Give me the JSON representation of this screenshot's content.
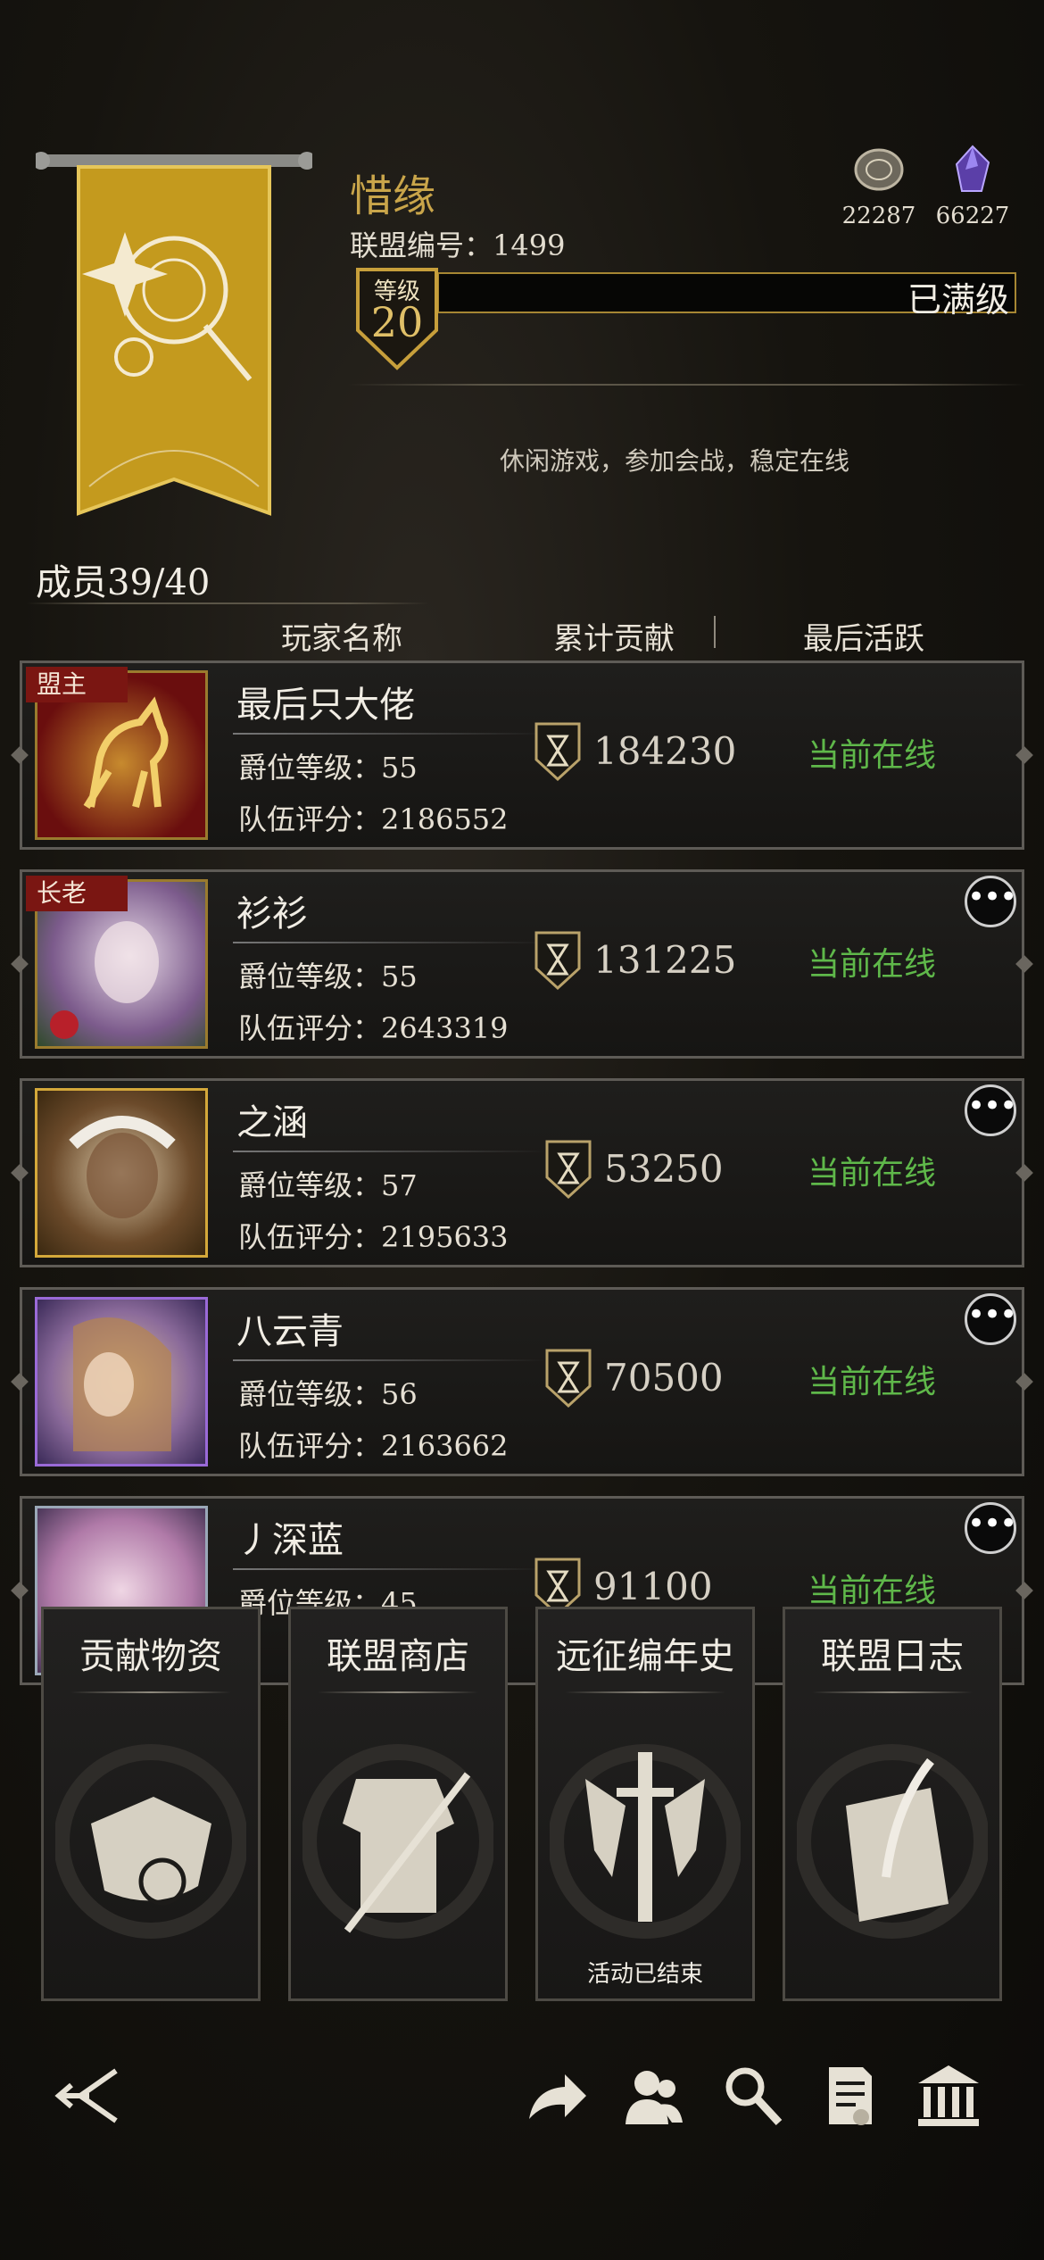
{
  "alliance": {
    "name": "惜缘",
    "id_label": "联盟编号：1499",
    "level_label": "等级",
    "level": "20",
    "level_status": "已满级",
    "slogan": "休闲游戏，参加会战，稳定在线",
    "members": "成员39/40"
  },
  "currencies": [
    {
      "icon": "coin-icon",
      "value": "22287"
    },
    {
      "icon": "crystal-icon",
      "value": "66227"
    }
  ],
  "table_headers": [
    "玩家名称",
    "累计贡献",
    "最后活跃"
  ],
  "members": [
    {
      "role": "盟主",
      "name": "最后只大佬",
      "level": "爵位等级：55",
      "score": "队伍评分：2186552",
      "contribution": "184230",
      "status": "当前在线"
    },
    {
      "role": "长老",
      "name": "衫衫",
      "level": "爵位等级：55",
      "score": "队伍评分：2643319",
      "contribution": "131225",
      "status": "当前在线"
    },
    {
      "role": "",
      "name": "之涵",
      "level": "爵位等级：57",
      "score": "队伍评分：2195633",
      "contribution": "53250",
      "status": "当前在线"
    },
    {
      "role": "",
      "name": "八云青",
      "level": "爵位等级：56",
      "score": "队伍评分：2163662",
      "contribution": "70500",
      "status": "当前在线"
    },
    {
      "role": "",
      "name": "丿深蓝",
      "level": "爵位等级：45",
      "score": "",
      "contribution": "91100",
      "status": "当前在线"
    }
  ],
  "cards": [
    {
      "title": "贡献物资",
      "note": ""
    },
    {
      "title": "联盟商店",
      "note": ""
    },
    {
      "title": "远征编年史",
      "note": "活动已结束"
    },
    {
      "title": "联盟日志",
      "note": ""
    }
  ],
  "more_label": "•••",
  "colors": {
    "gold": "#c9a54a",
    "online": "#5fb84a",
    "role_tag": "#7a1612"
  }
}
